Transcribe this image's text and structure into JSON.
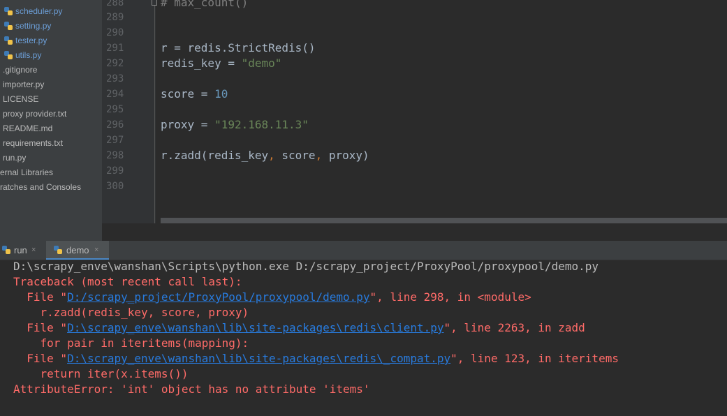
{
  "project_tree": {
    "items": [
      {
        "label": "scheduler.py",
        "type": "py"
      },
      {
        "label": "setting.py",
        "type": "py"
      },
      {
        "label": "tester.py",
        "type": "py"
      },
      {
        "label": "utils.py",
        "type": "py"
      },
      {
        "label": ".gitignore",
        "type": "file"
      },
      {
        "label": "importer.py",
        "type": "file"
      },
      {
        "label": "LICENSE",
        "type": "file"
      },
      {
        "label": "proxy provider.txt",
        "type": "file"
      },
      {
        "label": "README.md",
        "type": "file"
      },
      {
        "label": "requirements.txt",
        "type": "file"
      },
      {
        "label": "run.py",
        "type": "file"
      },
      {
        "label": "ernal Libraries",
        "type": "folder"
      },
      {
        "label": "ratches and Consoles",
        "type": "folder"
      }
    ]
  },
  "editor": {
    "line_numbers": [
      "288",
      "289",
      "290",
      "291",
      "292",
      "293",
      "294",
      "295",
      "296",
      "297",
      "298",
      "299",
      "300"
    ],
    "code": {
      "l288_comment": "# max_count()",
      "l291": "r = redis.StrictRedis()",
      "l292_pre": "redis_key = ",
      "l292_str": "\"demo\"",
      "l294_pre": "score = ",
      "l294_num": "10",
      "l296_pre": "proxy = ",
      "l296_str": "\"192.168.11.3\"",
      "l298_a": "r.zadd(redis_key",
      "l298_comma1": ",",
      "l298_b": " score",
      "l298_comma2": ",",
      "l298_c": " proxy)"
    }
  },
  "run_tabs": [
    {
      "label": "run",
      "close": "×"
    },
    {
      "label": "demo",
      "close": "×"
    }
  ],
  "console": {
    "command": "D:\\scrapy_enve\\wanshan\\Scripts\\python.exe D:/scrapy_project/ProxyPool/proxypool/demo.py",
    "traceback_header": "Traceback (most recent call last):",
    "frames": [
      {
        "prefix": "  File \"",
        "path": "D:/scrapy_project/ProxyPool/proxypool/demo.py",
        "suffix": "\", line 298, in <module>",
        "code": "    r.zadd(redis_key, score, proxy)"
      },
      {
        "prefix": "  File \"",
        "path": "D:\\scrapy_enve\\wanshan\\lib\\site-packages\\redis\\client.py",
        "suffix": "\", line 2263, in zadd",
        "code": "    for pair in iteritems(mapping):"
      },
      {
        "prefix": "  File \"",
        "path": "D:\\scrapy_enve\\wanshan\\lib\\site-packages\\redis\\_compat.py",
        "suffix": "\", line 123, in iteritems",
        "code": "    return iter(x.items())"
      }
    ],
    "error": "AttributeError: 'int' object has no attribute 'items'"
  },
  "colors": {
    "py_icon_blue": "#3e7bb6",
    "py_icon_yellow": "#f0c34a",
    "error_red": "#ff6b68",
    "link_blue": "#287bde"
  }
}
